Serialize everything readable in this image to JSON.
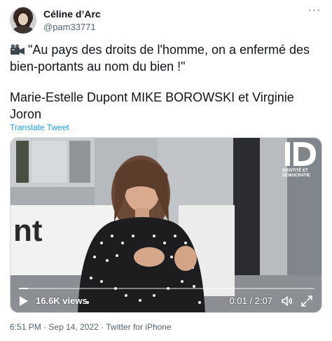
{
  "author": {
    "display_name": "Céline d’Arc",
    "handle": "@pam33771",
    "avatar_icon": "avatar-portrait"
  },
  "tweet": {
    "paragraph1": "\"Au pays des droits de l'homme, on a enfermé des bien-portants au nom du bien !\"",
    "paragraph2": "Marie-Estelle Dupont  MIKE BOROWSKI et Virginie Joron",
    "leading_icon": "movie-camera-emoji",
    "translate_label": "Translate Tweet"
  },
  "video": {
    "views": "16.6K views",
    "time": "0:01 / 2:07",
    "progress": 0.01,
    "overlay_text": "nt",
    "logo_text": "IDENTITÉ ET DÉMOCRATIE",
    "logo_mark": "ID"
  },
  "footer": {
    "time": "6:51 PM",
    "date": "Sep 14, 2022",
    "source": "Twitter for iPhone",
    "separator": "·"
  },
  "colors": {
    "link": "#1d9bf0",
    "secondary_text": "#536471",
    "primary_text": "#0f1419"
  }
}
